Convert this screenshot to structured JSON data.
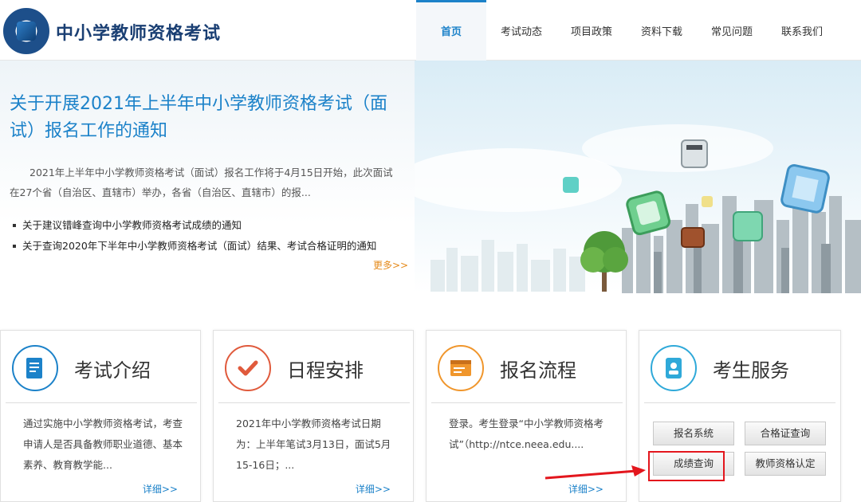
{
  "header": {
    "site_title": "中小学教师资格考试",
    "nav": [
      {
        "label": "首页",
        "active": true
      },
      {
        "label": "考试动态"
      },
      {
        "label": "项目政策"
      },
      {
        "label": "资料下载"
      },
      {
        "label": "常见问题"
      },
      {
        "label": "联系我们"
      }
    ]
  },
  "banner": {
    "title": "关于开展2021年上半年中小学教师资格考试（面试）报名工作的通知",
    "description": "2021年上半年中小学教师资格考试（面试）报名工作将于4月15日开始，此次面试在27个省（自治区、直辖市）举办，各省（自治区、直辖市）的报...",
    "news": [
      "关于建议错峰查询中小学教师资格考试成绩的通知",
      "关于查询2020年下半年中小学教师资格考试（面试）结果、考试合格证明的通知"
    ],
    "more": "更多>>"
  },
  "cards": [
    {
      "title": "考试介绍",
      "body": "通过实施中小学教师资格考试，考查申请人是否具备教师职业道德、基本素养、教育教学能...",
      "more": "详细>>"
    },
    {
      "title": "日程安排",
      "body": "2021年中小学教师资格考试日期为：上半年笔试3月13日，面试5月15-16日；...",
      "more": "详细>>"
    },
    {
      "title": "报名流程",
      "body": "登录。考生登录“中小学教师资格考试”（http://ntce.neea.edu....",
      "more": "详细>>"
    },
    {
      "title": "考生服务",
      "buttons": [
        "报名系统",
        "合格证查询",
        "成绩查询",
        "教师资格认定"
      ]
    }
  ],
  "colors": {
    "accent": "#1c82c9",
    "highlight": "#e3161d",
    "more_orange": "#e58a1a"
  }
}
